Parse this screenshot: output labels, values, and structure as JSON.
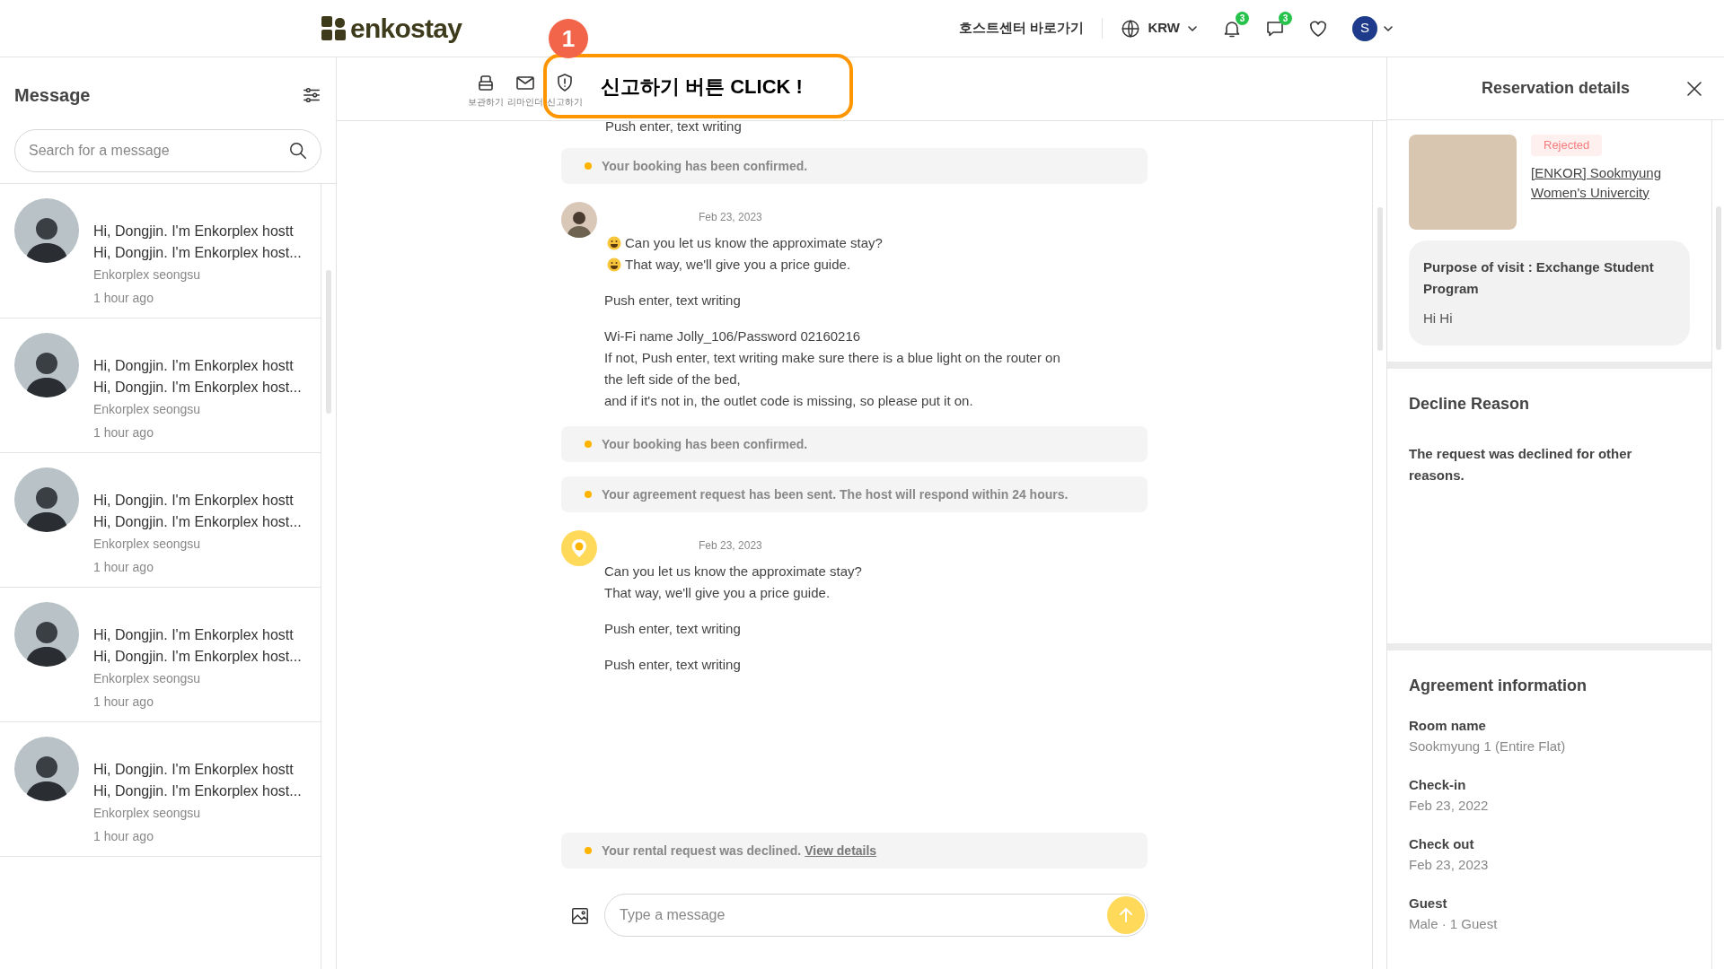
{
  "header": {
    "logo": "enkostay",
    "host_center_link": "호스트센터 바로가기",
    "currency": "KRW",
    "notification_count": "3",
    "message_count": "3",
    "user_initial": "S"
  },
  "callout": {
    "number": "1",
    "text": "신고하기 버튼 CLICK !"
  },
  "inbox": {
    "title": "Message",
    "search": {
      "placeholder": "Search for a message"
    },
    "conversations": [
      {
        "preview_1": "Hi, Dongjin. I'm Enkorplex hostt",
        "preview_2": "Hi, Dongjin. I'm Enkorplex host...",
        "sender": "Enkorplex seongsu",
        "time": "1 hour ago",
        "selected": false
      },
      {
        "preview_1": "Hi, Dongjin. I'm Enkorplex hostt",
        "preview_2": "Hi, Dongjin. I'm Enkorplex host...",
        "sender": "Enkorplex seongsu",
        "time": "1 hour ago",
        "selected": false
      },
      {
        "preview_1": "Hi, Dongjin. I'm Enkorplex hostt",
        "preview_2": "Hi, Dongjin. I'm Enkorplex host...",
        "sender": "Enkorplex seongsu",
        "time": "1 hour ago",
        "selected": false
      },
      {
        "preview_1": "Hi, Dongjin. I'm Enkorplex hostt",
        "preview_2": "Hi, Dongjin. I'm Enkorplex host...",
        "sender": "Enkorplex seongsu",
        "time": "1 hour ago",
        "selected": false
      },
      {
        "preview_1": "Hi, Dongjin. I'm Enkorplex hostt",
        "preview_2": "Hi, Dongjin. I'm Enkorplex host...",
        "sender": "Enkorplex seongsu",
        "time": "1 hour ago",
        "selected": false
      }
    ]
  },
  "toolbar": [
    {
      "kind": "archive",
      "label": "보관하기"
    },
    {
      "kind": "reminder",
      "label": "리마인더"
    },
    {
      "kind": "report",
      "label": "신고하기"
    }
  ],
  "chat": {
    "items": [
      {
        "kind": "fragment",
        "text": "Push enter, text writing"
      },
      {
        "kind": "notice",
        "text": "Your booking has been confirmed."
      },
      {
        "kind": "message",
        "avatar": {
          "kind": "photo"
        },
        "date": "Feb 23, 2023",
        "paragraphs": [
          [
            {
              "text": "Can you let us know the approximate stay?",
              "emoji": true
            },
            {
              "text": "That way, we'll give you a price guide.",
              "emoji": true
            }
          ],
          [
            {
              "text": "Push enter, text writing",
              "emoji": false
            }
          ],
          [
            {
              "text": "Wi-Fi name Jolly_106/Password 02160216",
              "emoji": false
            },
            {
              "text": "If not, Push enter, text writing make sure there is a blue light on the router on",
              "emoji": false
            },
            {
              "text": "the left side of the bed,",
              "emoji": false
            },
            {
              "text": "and if it's not in, the outlet code is missing, so please put it on.",
              "emoji": false
            }
          ]
        ]
      },
      {
        "kind": "notice",
        "text": "Your booking has been confirmed."
      },
      {
        "kind": "notice",
        "text": "Your agreement request has been sent. The host will respond within 24 hours."
      },
      {
        "kind": "message",
        "avatar": {
          "kind": "pin"
        },
        "date": "Feb 23, 2023",
        "paragraphs": [
          [
            {
              "text": "Can you let us know the approximate stay?",
              "emoji": false
            },
            {
              "text": "That way, we'll give you a price guide.",
              "emoji": false
            }
          ],
          [
            {
              "text": "Push enter, text writing",
              "emoji": false
            }
          ],
          [
            {
              "text": "Push enter, text writing",
              "emoji": false
            }
          ]
        ]
      },
      {
        "kind": "spacer"
      },
      {
        "kind": "notice",
        "text": "Your rental request was declined.",
        "link": "View details"
      }
    ]
  },
  "composer": {
    "placeholder": "Type a message"
  },
  "details": {
    "title": "Reservation details",
    "status": "Rejected",
    "listing": "[ENKOR] Sookmyung Women's Univercity",
    "purpose": "Purpose of visit : Exchange Student Program",
    "note": "Hi Hi",
    "decline": {
      "title": "Decline Reason",
      "text": "The request was declined for other reasons."
    },
    "agreement": {
      "title": "Agreement information",
      "fields": [
        {
          "label": "Room name",
          "value": "Sookmyung 1 (Entire Flat)"
        },
        {
          "label": "Check-in",
          "value": "Feb 23, 2022"
        },
        {
          "label": "Check out",
          "value": "Feb 23, 2023"
        },
        {
          "label": "Guest",
          "value": "Male · 1 Guest"
        }
      ]
    }
  }
}
